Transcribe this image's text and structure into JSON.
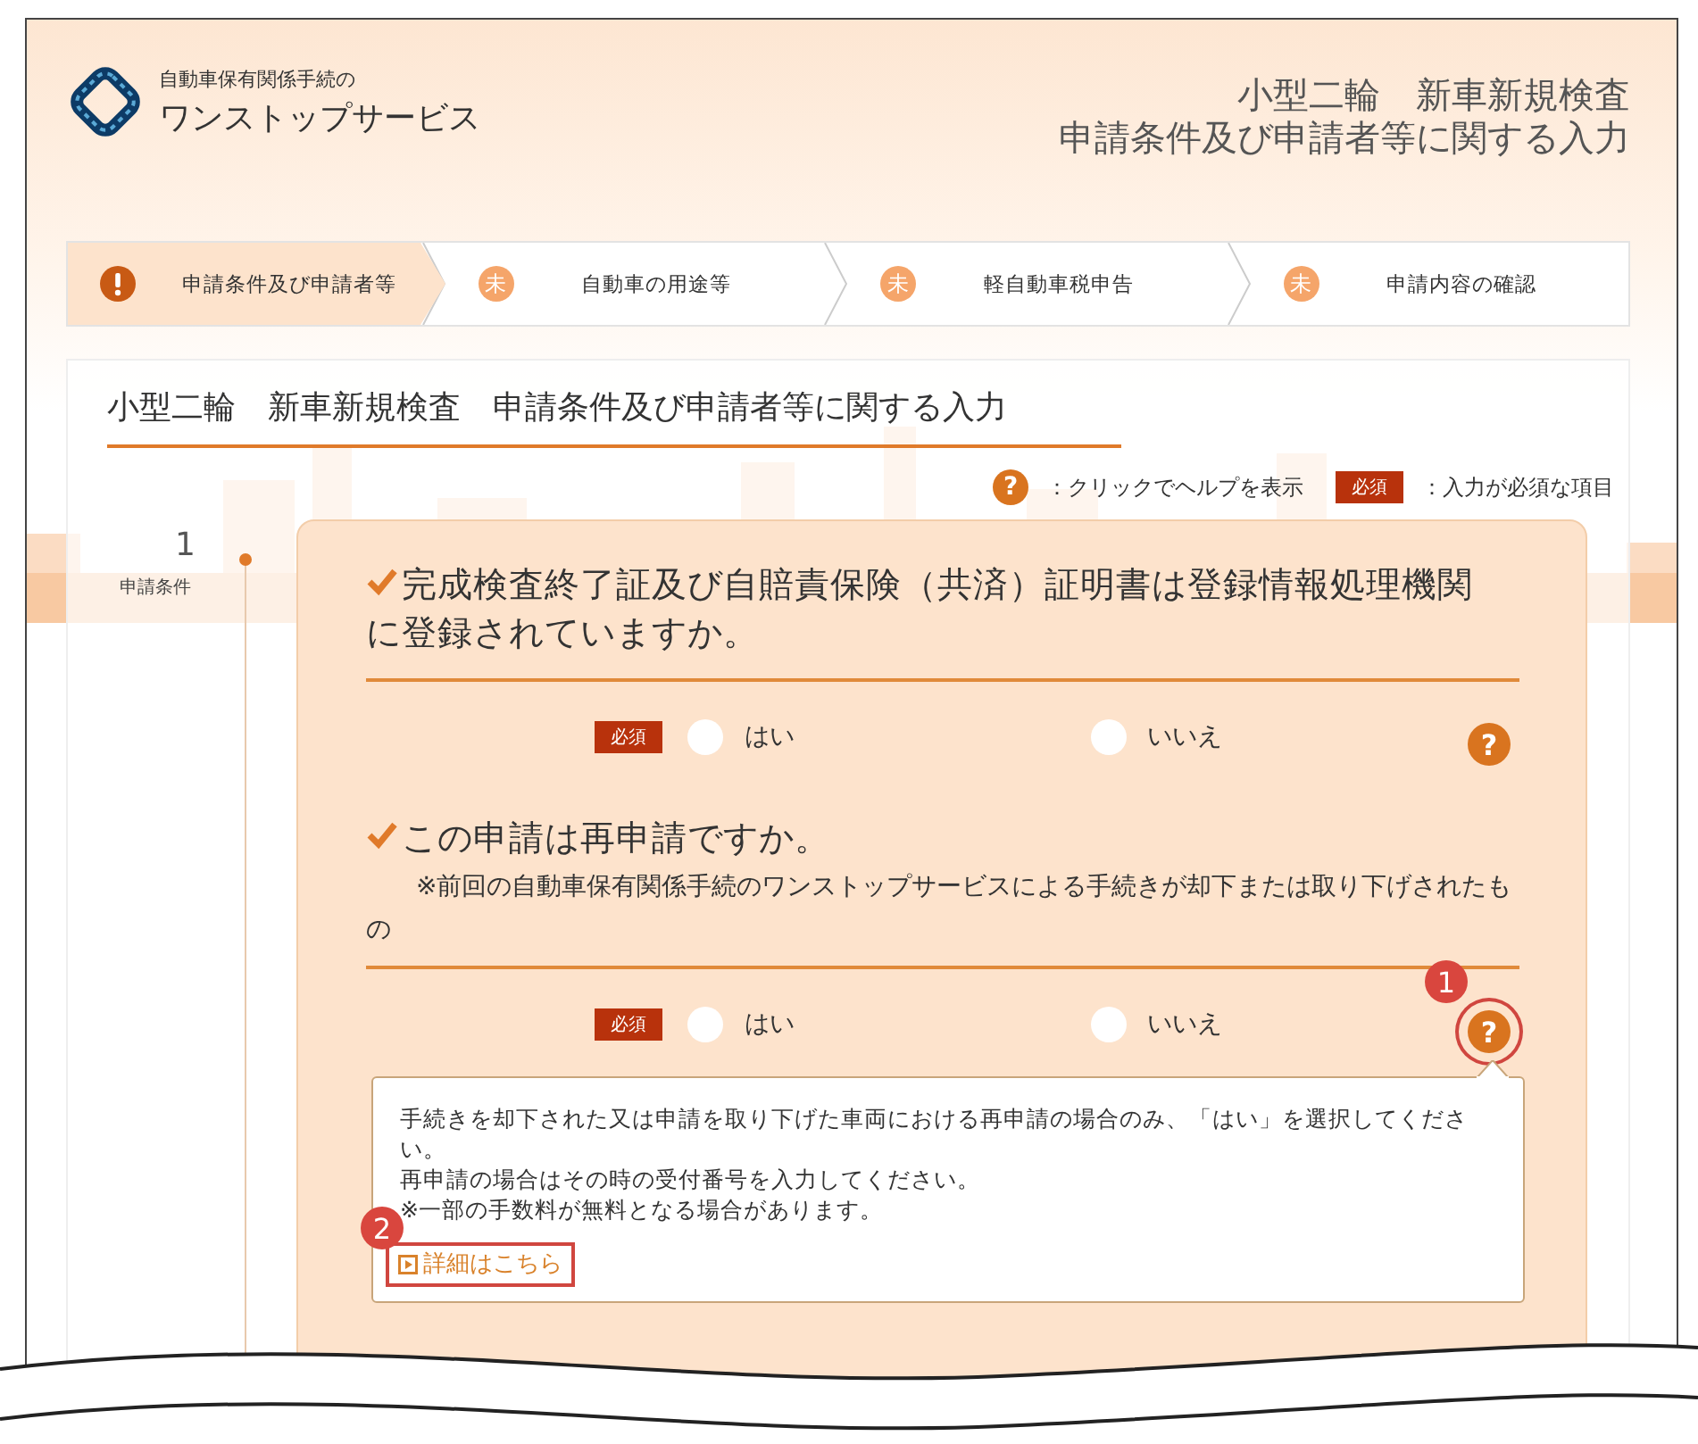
{
  "header": {
    "logo_caption": "自動車保有関係手続の",
    "logo_title": "ワンストップサービス",
    "page_title": [
      "小型二輪　新車新規検査",
      "申請条件及び申請者等に関する入力"
    ]
  },
  "steps": [
    {
      "kind": "warning",
      "label": "申請条件及び申請者等",
      "selected": true
    },
    {
      "kind": "pending",
      "badge": "未",
      "label": "自動車の用途等",
      "selected": false
    },
    {
      "kind": "pending",
      "badge": "未",
      "label": "軽自動車税申告",
      "selected": false
    },
    {
      "kind": "pending",
      "badge": "未",
      "label": "申請内容の確認",
      "selected": false
    }
  ],
  "section": {
    "title": "小型二輪　新車新規検査　申請条件及び申請者等に関する入力",
    "legend": {
      "help_symbol": "?",
      "help_text": "：クリックでヘルプを表示",
      "required_badge": "必須",
      "required_text": "：入力が必須な項目"
    },
    "step": {
      "number": "1",
      "label": "申請条件"
    },
    "questions": [
      {
        "title": "完成検査終了証及び自賠責保険（共済）証明書は登録情報処理機関に登録されていますか。",
        "required_badge": "必須",
        "options": [
          {
            "label": "はい",
            "selected": false
          },
          {
            "label": "いいえ",
            "selected": false
          }
        ],
        "help_symbol": "?"
      },
      {
        "title": "この申請は再申請ですか。",
        "note": "※前回の自動車保有関係手続のワンストップサービスによる手続きが却下または取り下げされたもの",
        "required_badge": "必須",
        "options": [
          {
            "label": "はい",
            "selected": false
          },
          {
            "label": "いいえ",
            "selected": false
          }
        ],
        "help_symbol": "?",
        "annotation": "1",
        "popup": {
          "lines": [
            "手続きを却下された又は申請を取り下げた車両における再申請の場合のみ、「はい」を選択してください。",
            "再申請の場合はその時の受付番号を入力してください。",
            "※一部の手数料が無料となる場合があります。"
          ],
          "link": {
            "label": "詳細はこちら",
            "annotation": "2"
          }
        }
      }
    ]
  }
}
